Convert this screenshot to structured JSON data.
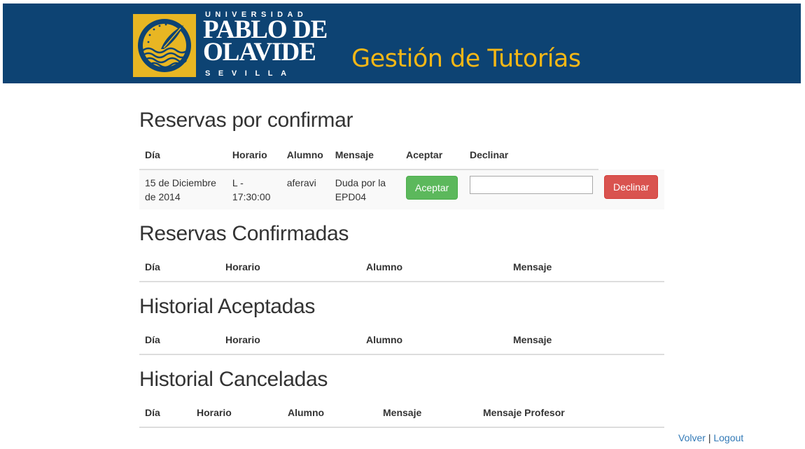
{
  "header": {
    "logo": {
      "top_text": "UNIVERSIDAD",
      "main_line1": "PABLO DE",
      "main_line2": "OLAVIDE",
      "bottom_text": "SEVILLA"
    },
    "title": "Gestión de Tutorías"
  },
  "pending": {
    "heading": "Reservas por confirmar",
    "columns": [
      "Día",
      "Horario",
      "Alumno",
      "Mensaje",
      "Aceptar",
      "Declinar"
    ],
    "rows": [
      {
        "dia": "15 de Diciembre de 2014",
        "horario": "L - 17:30:00",
        "alumno": "aferavi",
        "mensaje": "Duda por la EPD04",
        "accept_label": "Aceptar",
        "decline_input_value": "",
        "decline_label": "Declinar"
      }
    ]
  },
  "confirmed": {
    "heading": "Reservas Confirmadas",
    "columns": [
      "Día",
      "Horario",
      "Alumno",
      "Mensaje"
    ]
  },
  "history_accepted": {
    "heading": "Historial Aceptadas",
    "columns": [
      "Día",
      "Horario",
      "Alumno",
      "Mensaje"
    ]
  },
  "history_cancelled": {
    "heading": "Historial Canceladas",
    "columns": [
      "Día",
      "Horario",
      "Alumno",
      "Mensaje",
      "Mensaje Profesor"
    ]
  },
  "footer": {
    "back_label": "Volver",
    "separator": "|",
    "logout_label": "Logout"
  },
  "colors": {
    "banner": "#0d4373",
    "title": "#f5b716",
    "seal": "#e8b623",
    "accept": "#5cb85c",
    "decline": "#d9534f",
    "link": "#337ab7"
  }
}
